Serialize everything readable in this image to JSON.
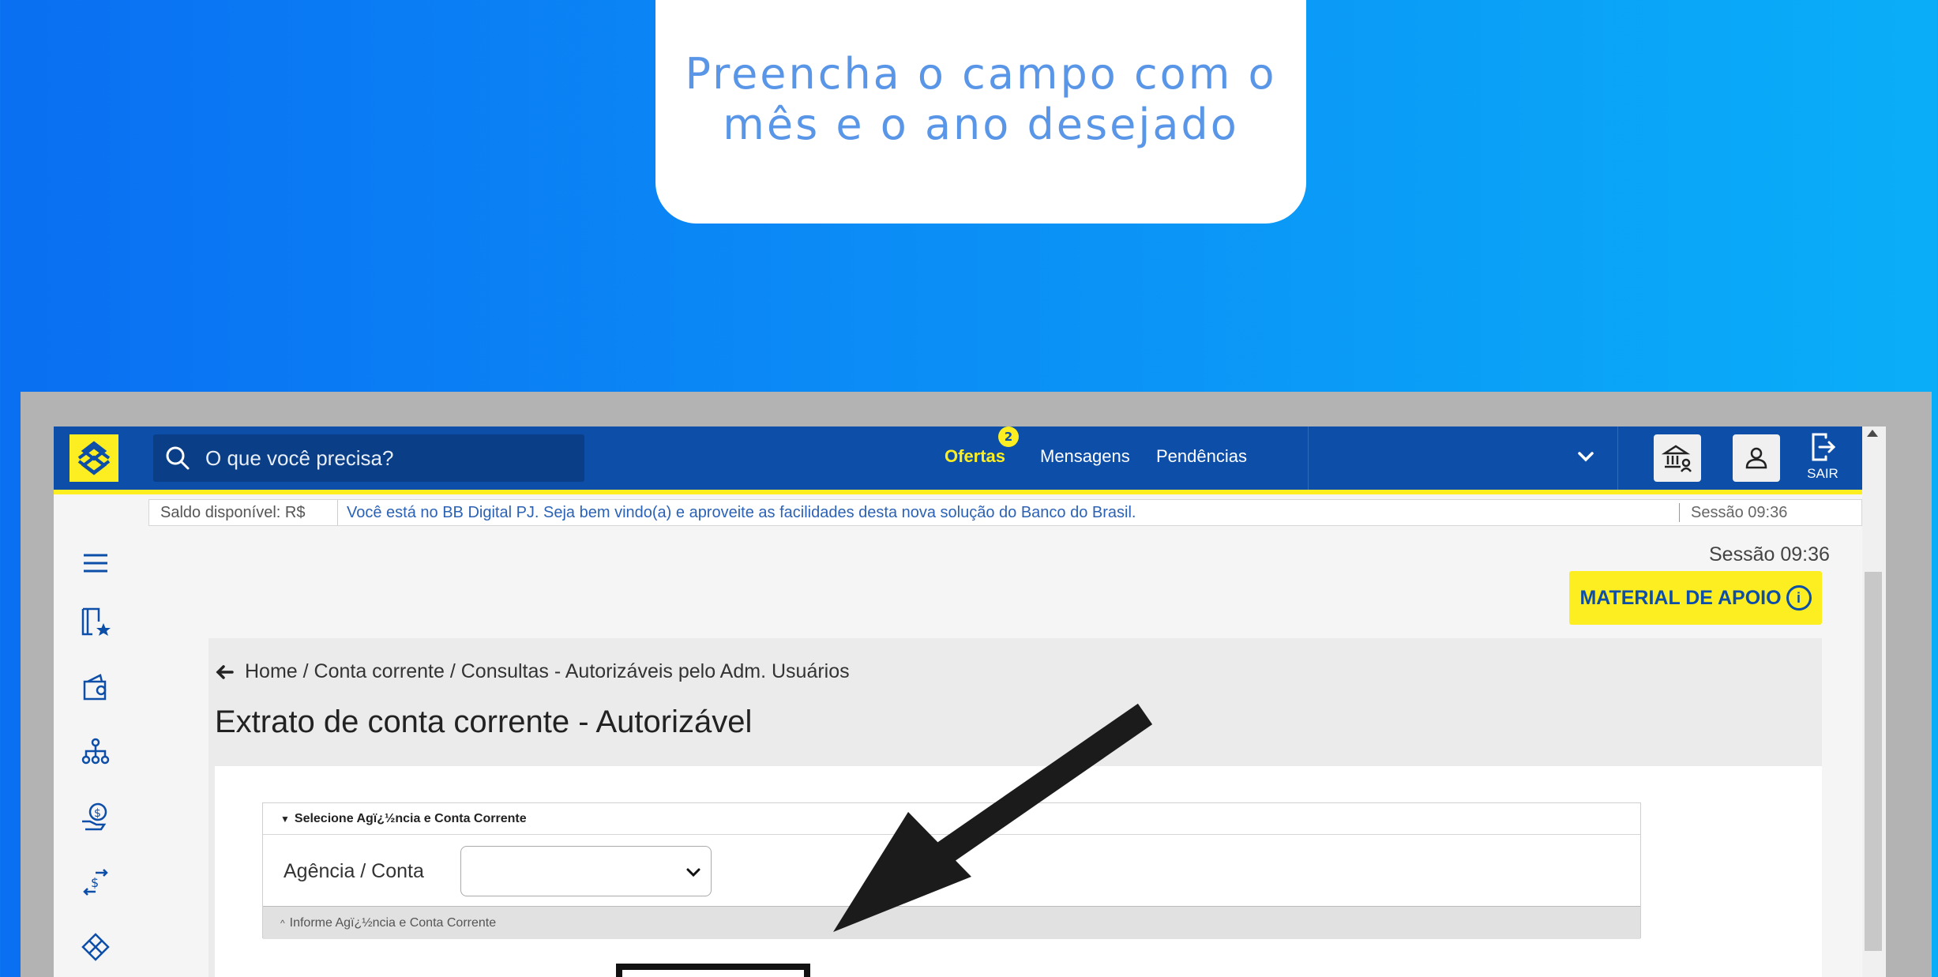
{
  "tip": {
    "text_line1": "Preencha o campo com o",
    "text_line2": "mês e o ano desejado"
  },
  "topbar": {
    "search_placeholder": "O que você precisa?",
    "nav": {
      "ofertas": "Ofertas",
      "ofertas_badge": "2",
      "mensagens": "Mensagens",
      "pendencias": "Pendências"
    },
    "sair_label": "SAIR"
  },
  "infobar": {
    "saldo": "Saldo disponível:  R$",
    "message": "Você está no BB Digital PJ. Seja bem vindo(a) e aproveite as facilidades desta nova solução do Banco do Brasil.",
    "session": "Sessão 09:36"
  },
  "session_right": "Sessão 09:36",
  "material_button": "MATERIAL DE APOIO",
  "breadcrumb": "Home / Conta corrente / Consultas - Autorizáveis pelo Adm. Usuários",
  "page_title": "Extrato de conta corrente - Autorizável",
  "form": {
    "section_header": "Selecione Agï¿½ncia e Conta Corrente",
    "field_label": "Agência / Conta",
    "select_value": "",
    "section_footer": "Informe Agï¿½ncia e Conta Corrente"
  },
  "colors": {
    "brand_blue": "#0c4ea8",
    "brand_yellow": "#fcee21",
    "background_gradient_start": "#0a6ff2",
    "background_gradient_end": "#0aaef8"
  },
  "icons": {
    "sidebar": [
      "menu-icon",
      "favorites-icon",
      "wallet-icon",
      "hierarchy-icon",
      "payments-icon",
      "transfer-icon",
      "diamond-icon"
    ],
    "topbar": [
      "bb-logo-icon",
      "search-icon",
      "chevron-down-icon",
      "bank-agency-icon",
      "user-icon",
      "exit-icon"
    ]
  }
}
